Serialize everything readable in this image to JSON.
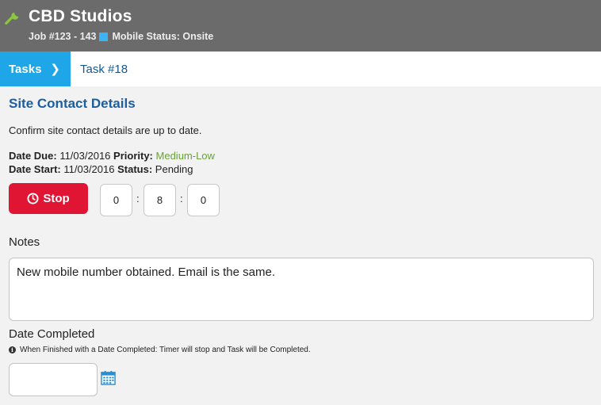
{
  "header": {
    "title": "CBD Studios",
    "job": "Job #123 - 143",
    "mobile_status": "Mobile Status: Onsite",
    "status_color": "#3ab4f2",
    "icon": "wrench-icon"
  },
  "breadcrumb": {
    "tasks_label": "Tasks",
    "current": "Task #18"
  },
  "task": {
    "title": "Site Contact Details",
    "description": "Confirm site contact details are up to date.",
    "date_due_label": "Date Due:",
    "date_due": "11/03/2016",
    "priority_label": "Priority:",
    "priority": "Medium-Low",
    "date_start_label": "Date Start:",
    "date_start": "11/03/2016",
    "status_label": "Status:",
    "status": "Pending"
  },
  "timer": {
    "stop_label": "Stop",
    "hours": "0",
    "minutes": "8",
    "seconds": "0"
  },
  "notes": {
    "label": "Notes",
    "value": "New mobile number obtained. Email is the same."
  },
  "date_completed": {
    "label": "Date Completed",
    "hint": "When Finished with a Date Completed: Timer will stop and Task will be Completed.",
    "value": ""
  },
  "colors": {
    "header_bg": "#6b6b6b",
    "accent_blue": "#1ea6e8",
    "title_blue": "#1b5fa0",
    "stop_red": "#e01534",
    "priority_green": "#6aa03a"
  }
}
